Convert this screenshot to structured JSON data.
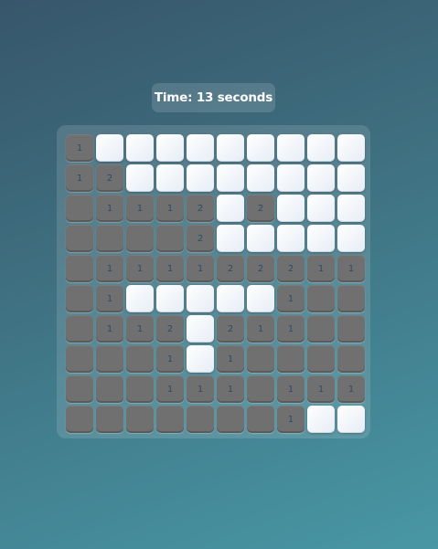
{
  "timer": {
    "label": "Time: 13 seconds"
  },
  "board": {
    "rows": 10,
    "cols": 10,
    "cells": [
      [
        "1",
        "H",
        "H",
        "H",
        "H",
        "H",
        "H",
        "H",
        "H",
        "H"
      ],
      [
        "1",
        "2",
        "H",
        "H",
        "H",
        "H",
        "H",
        "H",
        "H",
        "H"
      ],
      [
        "",
        "1",
        "1",
        "1",
        "2",
        "H",
        "2",
        "H",
        "H",
        "H"
      ],
      [
        "",
        "",
        "",
        "",
        "2",
        "H",
        "H",
        "H",
        "H",
        "H"
      ],
      [
        "",
        "1",
        "1",
        "1",
        "1",
        "2",
        "2",
        "2",
        "1",
        "1"
      ],
      [
        "",
        "1",
        "H",
        "H",
        "H",
        "H",
        "H",
        "1",
        "",
        ""
      ],
      [
        "",
        "1",
        "1",
        "2",
        "H",
        "2",
        "1",
        "1",
        "",
        ""
      ],
      [
        "",
        "",
        "",
        "1",
        "H",
        "1",
        "",
        "",
        "",
        ""
      ],
      [
        "",
        "",
        "",
        "1",
        "1",
        "1",
        "",
        "1",
        "1",
        "1"
      ],
      [
        "",
        "",
        "",
        "",
        "",
        "",
        "",
        "1",
        "H",
        "H"
      ]
    ]
  },
  "colors": {
    "revealed": "#707070",
    "hidden": "#f2f6fb",
    "number": "#2e4b66"
  }
}
